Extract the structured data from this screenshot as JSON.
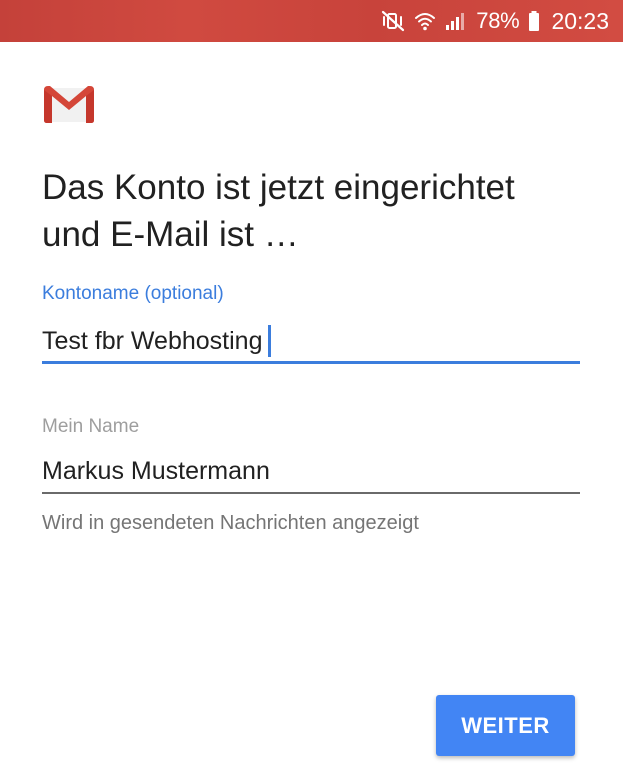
{
  "status_bar": {
    "battery_percent": "78%",
    "time": "20:23",
    "icons": [
      "mute-vibrate-icon",
      "wifi-icon",
      "signal-icon",
      "battery-icon"
    ],
    "color": "#c8433b"
  },
  "app": {
    "logo": "gmail-logo"
  },
  "title": "Das Konto ist jetzt eingerichtet und E-Mail ist …",
  "account_name_field": {
    "label": "Kontoname (optional)",
    "value": "Test fbr Webhosting",
    "focused": true
  },
  "your_name_field": {
    "label": "Mein Name",
    "value": "Markus Mustermann",
    "helper": "Wird in gesendeten Nachrichten angezeigt"
  },
  "next_button": {
    "label": "WEITER"
  },
  "colors": {
    "accent": "#3b7ddd",
    "button": "#4285f4",
    "status_bar": "#c8433b"
  }
}
